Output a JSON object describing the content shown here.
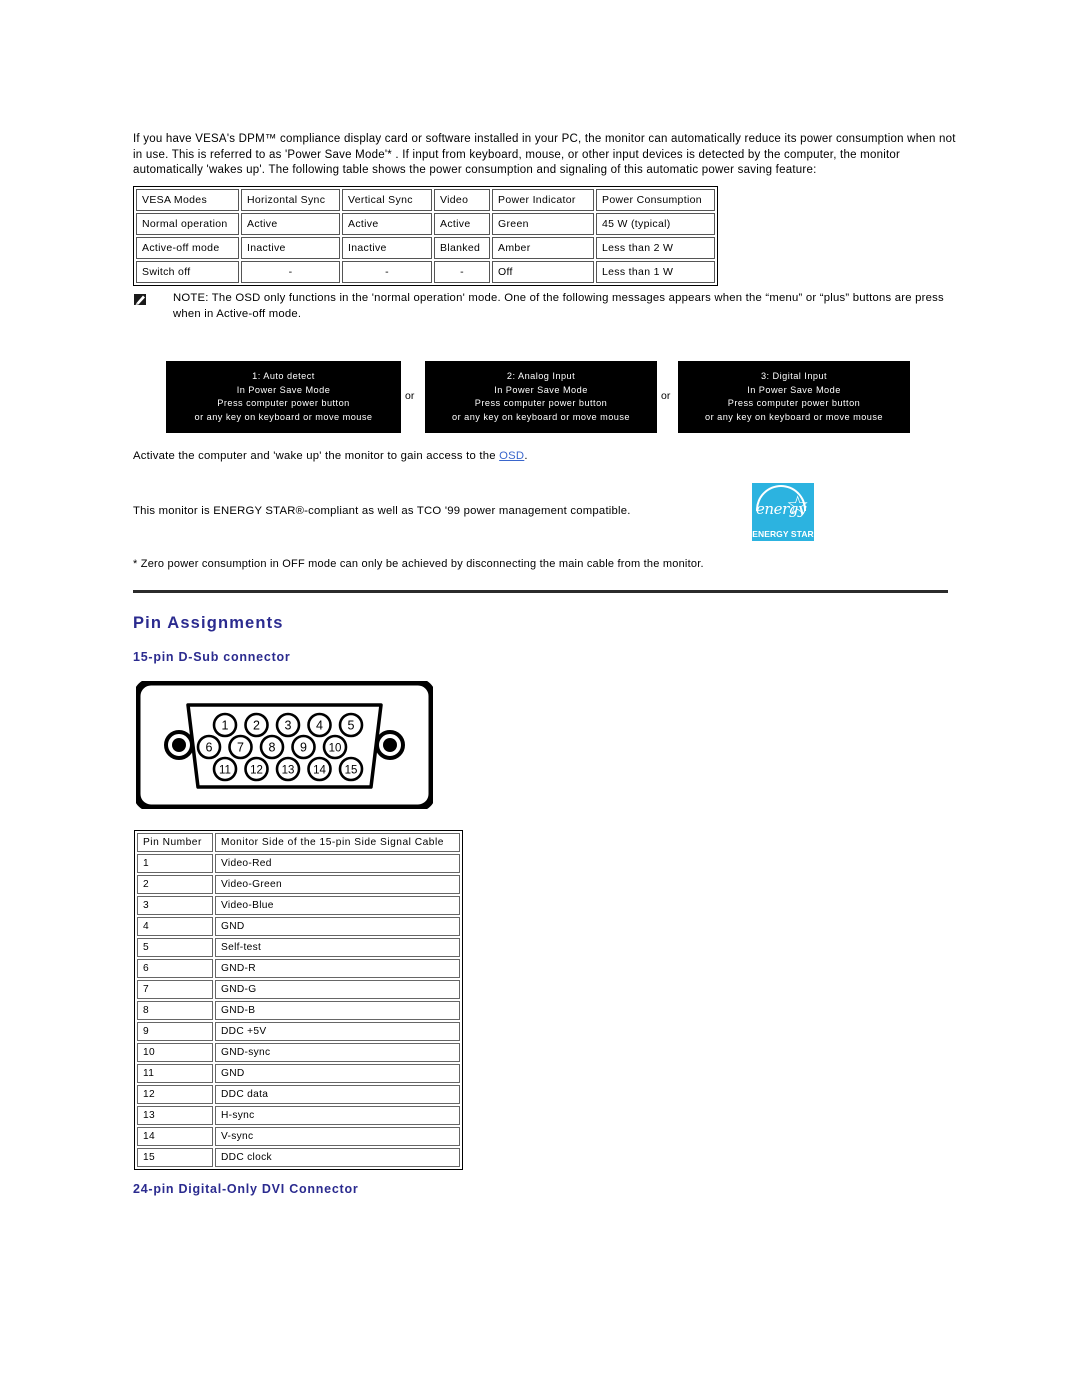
{
  "intro": {
    "paragraph": "If you have VESA's DPM™ compliance display card or software installed in your PC, the monitor can automatically reduce its power consumption when not in use. This is referred to as 'Power Save Mode'* . If input from keyboard, mouse, or other input devices is detected by the computer, the monitor automatically 'wakes up'. The following table shows the power consumption and signaling of this automatic power saving feature:"
  },
  "power_table": {
    "headers": [
      "VESA Modes",
      "Horizontal Sync",
      "Vertical Sync",
      "Video",
      "Power Indicator",
      "Power Consumption"
    ],
    "rows": [
      [
        "Normal operation",
        "Active",
        "Active",
        "Active",
        "Green",
        "45 W (typical)"
      ],
      [
        "Active-off mode",
        "Inactive",
        "Inactive",
        "Blanked",
        "Amber",
        "Less than 2 W"
      ],
      [
        "Switch off",
        "-",
        "-",
        "-",
        "Off",
        "Less than 1 W"
      ]
    ]
  },
  "note": {
    "icon": "note-pencil-icon",
    "line1": "NOTE: The OSD only functions in the 'normal operation' mode. One of the following messages appears when the “menu” or “plus” buttons are press",
    "line2": "when in Active-off mode."
  },
  "osd_messages": {
    "or_label": "or",
    "boxes": [
      {
        "line1": "1: Auto detect",
        "line2": "In Power Save Mode",
        "line3": "Press computer power button",
        "line4": "or any key on keyboard or move mouse"
      },
      {
        "line1": "2: Analog Input",
        "line2": "In Power Save Mode",
        "line3": "Press computer power button",
        "line4": "or any key on keyboard or move mouse"
      },
      {
        "line1": "3: Digital Input",
        "line2": "In Power Save Mode",
        "line3": "Press computer power button",
        "line4": "or any key on keyboard or move mouse"
      }
    ]
  },
  "activate": {
    "prefix": "Activate the computer and 'wake up' the monitor to gain access to the ",
    "link": "OSD",
    "suffix": "."
  },
  "energy_star": {
    "text": "This monitor is ENERGY STAR®-compliant as well as TCO '99 power management compatible.",
    "logo_script": "energy",
    "logo_bar": "ENERGY STAR",
    "logo_color": "#2cb3e0"
  },
  "footnote": {
    "text": "* Zero power consumption in OFF mode can only be achieved by disconnecting the main cable from the monitor."
  },
  "headings": {
    "pin_assignments": "Pin Assignments",
    "dsub": "15-pin D-Sub connector",
    "dvi": "24-pin Digital-Only DVI Connector",
    "color": "#2b2b8f"
  },
  "connector_diagram": {
    "name": "15-pin-d-sub-connector-diagram",
    "row1": [
      "1",
      "2",
      "3",
      "4",
      "5"
    ],
    "row2": [
      "6",
      "7",
      "8",
      "9",
      "10"
    ],
    "row3": [
      "11",
      "12",
      "13",
      "14",
      "15"
    ]
  },
  "pin_table": {
    "headers": [
      "Pin Number",
      "Monitor Side of the 15-pin Side Signal Cable"
    ],
    "rows": [
      [
        "1",
        "Video-Red"
      ],
      [
        "2",
        "Video-Green"
      ],
      [
        "3",
        "Video-Blue"
      ],
      [
        "4",
        "GND"
      ],
      [
        "5",
        "Self-test"
      ],
      [
        "6",
        "GND-R"
      ],
      [
        "7",
        "GND-G"
      ],
      [
        "8",
        "GND-B"
      ],
      [
        "9",
        "DDC +5V"
      ],
      [
        "10",
        "GND-sync"
      ],
      [
        "11",
        "GND"
      ],
      [
        "12",
        "DDC data"
      ],
      [
        "13",
        "H-sync"
      ],
      [
        "14",
        "V-sync"
      ],
      [
        "15",
        "DDC clock"
      ]
    ]
  }
}
